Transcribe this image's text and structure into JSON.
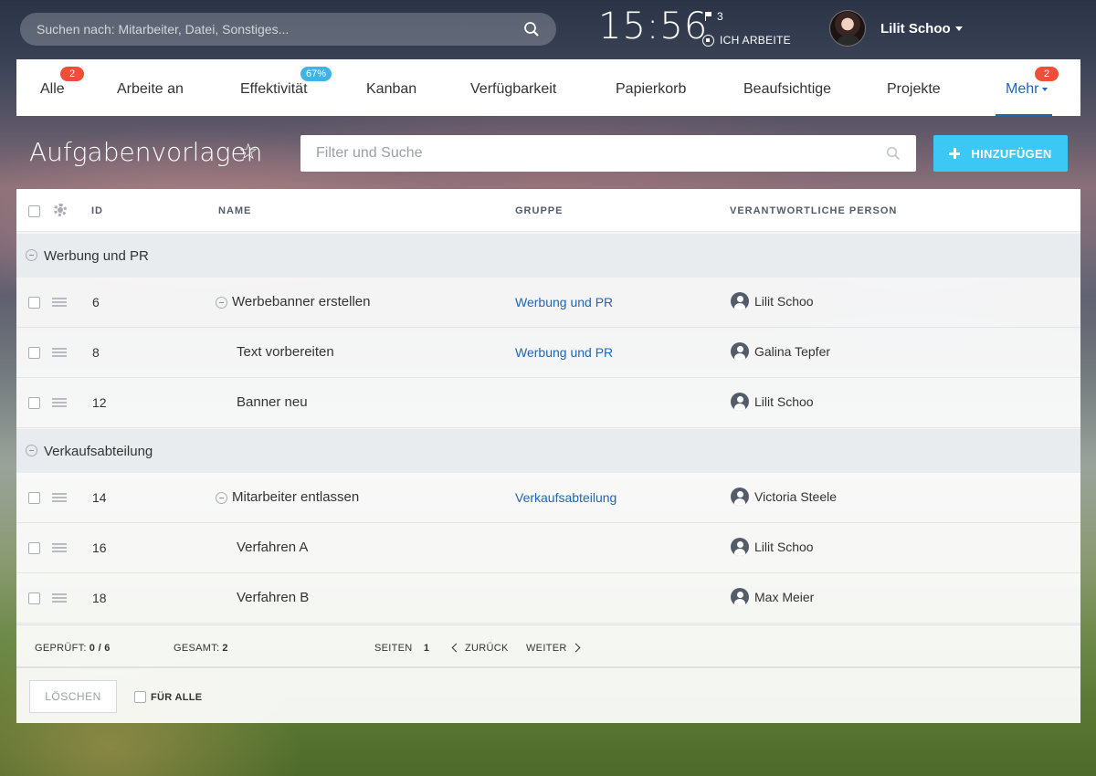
{
  "topbar": {
    "search_placeholder": "Suchen nach: Mitarbeiter, Datei, Sonstiges...",
    "clock": "15:56",
    "flag_count": "3",
    "work_status": "ICH ARBEITE",
    "user_name": "Lilit Schoo"
  },
  "tabs": [
    {
      "label": "Alle",
      "badge": "2"
    },
    {
      "label": "Arbeite an"
    },
    {
      "label": "Effektivität",
      "badge": "67%"
    },
    {
      "label": "Kanban"
    },
    {
      "label": "Verfügbarkeit"
    },
    {
      "label": "Papierkorb"
    },
    {
      "label": "Beaufsichtige"
    },
    {
      "label": "Projekte"
    },
    {
      "label": "Mehr",
      "badge": "2",
      "active": true
    }
  ],
  "header": {
    "title": "Aufgabenvorlagen",
    "filter_placeholder": "Filter und Suche",
    "add_label": "HINZUFÜGEN"
  },
  "table": {
    "columns": {
      "id": "ID",
      "name": "NAME",
      "group": "GRUPPE",
      "person": "VERANTWORTLICHE PERSON"
    },
    "groups": [
      {
        "label": "Werbung und PR",
        "rows": [
          {
            "id": "6",
            "name": "Werbebanner erstellen",
            "group": "Werbung und PR",
            "person": "Lilit Schoo",
            "collapsible": true
          },
          {
            "id": "8",
            "name": "Text vorbereiten",
            "group": "Werbung und PR",
            "person": "Galina Tepfer"
          },
          {
            "id": "12",
            "name": "Banner neu",
            "group": "",
            "person": "Lilit Schoo"
          }
        ]
      },
      {
        "label": "Verkaufsabteilung",
        "rows": [
          {
            "id": "14",
            "name": "Mitarbeiter entlassen",
            "group": "Verkaufsabteilung",
            "person": "Victoria Steele",
            "collapsible": true
          },
          {
            "id": "16",
            "name": "Verfahren A",
            "group": "",
            "person": "Lilit Schoo"
          },
          {
            "id": "18",
            "name": "Verfahren B",
            "group": "",
            "person": "Max Meier"
          }
        ]
      }
    ]
  },
  "footer": {
    "checked_label": "GEPRÜFT:",
    "checked_value": "0 / 6",
    "total_label": "GESAMT:",
    "total_value": "2",
    "pages_label": "SEITEN",
    "pages_value": "1",
    "back_label": "ZURÜCK",
    "next_label": "WEITER",
    "delete_label": "LÖSCHEN",
    "for_all_label": "FÜR ALLE"
  },
  "colors": {
    "accent": "#2067b0",
    "add_button": "#3bc8f5",
    "badge_red": "#f04e39",
    "badge_blue": "#3db4e5"
  }
}
